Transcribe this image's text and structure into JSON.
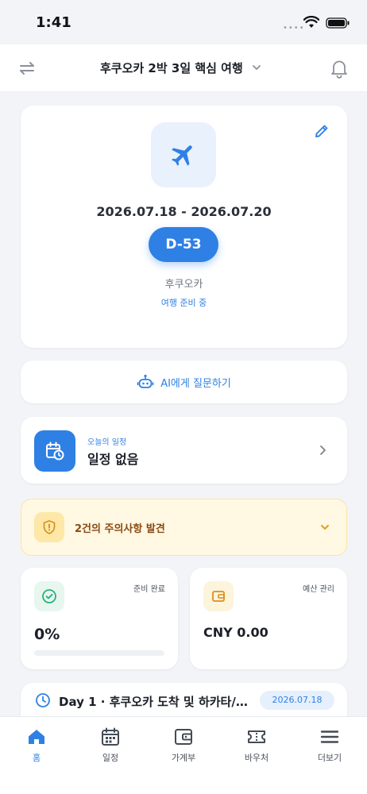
{
  "status_bar": {
    "time": "1:41"
  },
  "header": {
    "title": "후쿠오카 2박 3일 핵심 여행"
  },
  "trip": {
    "dates": "2026.07.18 - 2026.07.20",
    "dday": "D-53",
    "city": "후쿠오카",
    "status": "여행 준비 중"
  },
  "ai": {
    "label": "AI에게 질문하기"
  },
  "schedule": {
    "label": "오늘의 일정",
    "value": "일정 없음"
  },
  "alert": {
    "text": "2건의 주의사항 발견"
  },
  "prep": {
    "label": "준비 완료",
    "value": "0%",
    "progress": 0
  },
  "budget": {
    "label": "예산 관리",
    "value": "CNY 0.00"
  },
  "day": {
    "title": "Day 1 · 후쿠오카 도착 및 하카타/…",
    "date": "2026.07.18"
  },
  "tabs": [
    {
      "label": "홈",
      "icon": "home-icon",
      "active": true
    },
    {
      "label": "일정",
      "icon": "calendar-icon",
      "active": false
    },
    {
      "label": "가계부",
      "icon": "wallet-icon",
      "active": false
    },
    {
      "label": "바우처",
      "icon": "ticket-icon",
      "active": false
    },
    {
      "label": "더보기",
      "icon": "menu-icon",
      "active": false
    }
  ],
  "colors": {
    "accent": "#2f80e4",
    "warning_bg": "#fff8e3",
    "warning_text": "#8a4a12",
    "success": "#2bb07a"
  }
}
